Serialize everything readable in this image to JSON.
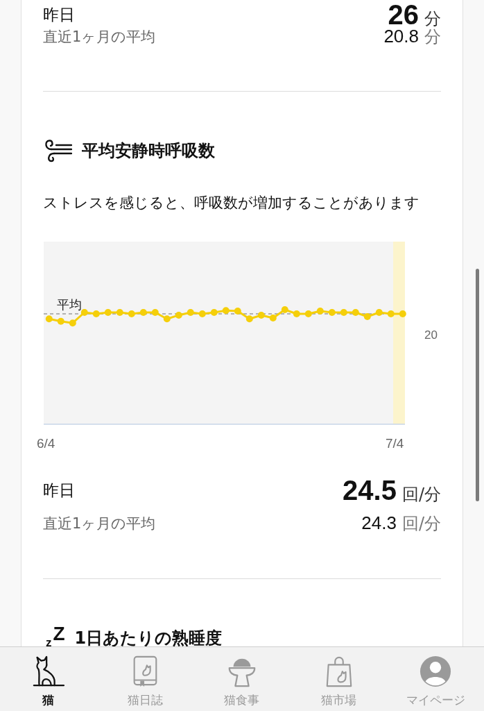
{
  "sections": [
    {
      "kind": "continued",
      "yesterday": {
        "label": "昨日",
        "value": "26",
        "unit": "分"
      },
      "month_average": {
        "label": "直近1ヶ月の平均",
        "value": "20.8",
        "unit": "分"
      }
    },
    {
      "kind": "wind",
      "title": "平均安静時呼吸数",
      "description": "ストレスを感じると、呼吸数が増加することがあります",
      "chart": {
        "average_label": "平均",
        "y_tick": "20",
        "x_labels": [
          "6/4",
          "7/4"
        ]
      },
      "yesterday": {
        "label": "昨日",
        "value": "24.5",
        "unit": "回/分"
      },
      "month_average": {
        "label": "直近1ヶ月の平均",
        "value": "24.3",
        "unit": "回/分"
      }
    },
    {
      "kind": "sleep",
      "icon_text": "z$^{Z}$",
      "title": "1日あたりの熟睡度"
    }
  ],
  "tab_bar": [
    {
      "kind": "cat",
      "label": "猫",
      "selected": true
    },
    {
      "kind": "diary",
      "label": "猫日誌",
      "selected": false
    },
    {
      "kind": "food",
      "label": "猫食事",
      "selected": false
    },
    {
      "kind": "shop",
      "label": "猫市場",
      "selected": false
    },
    {
      "kind": "profile",
      "label": "マイページ",
      "selected": false
    }
  ]
}
